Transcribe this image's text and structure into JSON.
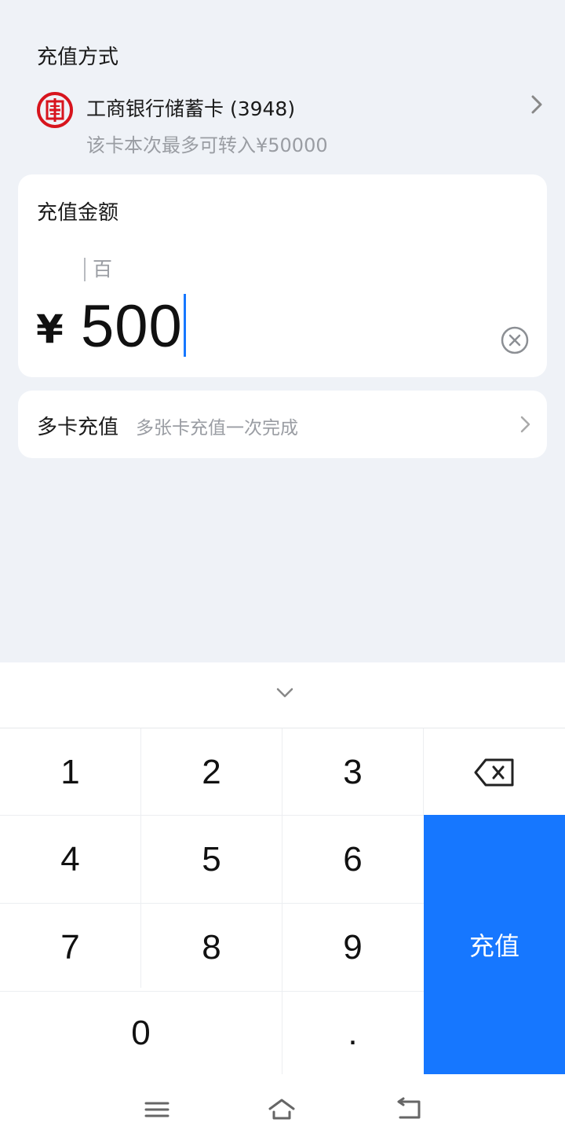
{
  "recharge_method": {
    "title": "充值方式",
    "bank": {
      "icon": "icbc-logo-icon",
      "name": "工商银行储蓄卡 (3948)",
      "limit_text": "该卡本次最多可转入¥50000"
    }
  },
  "amount": {
    "title": "充值金额",
    "unit_hint": "百",
    "currency_symbol": "¥",
    "value": "500"
  },
  "multi_card": {
    "title": "多卡充值",
    "subtitle": "多张卡充值一次完成"
  },
  "keypad": {
    "keys": [
      "1",
      "2",
      "3",
      "4",
      "5",
      "6",
      "7",
      "8",
      "9",
      "0",
      "."
    ],
    "confirm_label": "充值"
  },
  "colors": {
    "accent": "#1677ff",
    "background": "#eff2f7",
    "bank_logo_red": "#d7141d",
    "secondary_text": "#9a9da3"
  }
}
